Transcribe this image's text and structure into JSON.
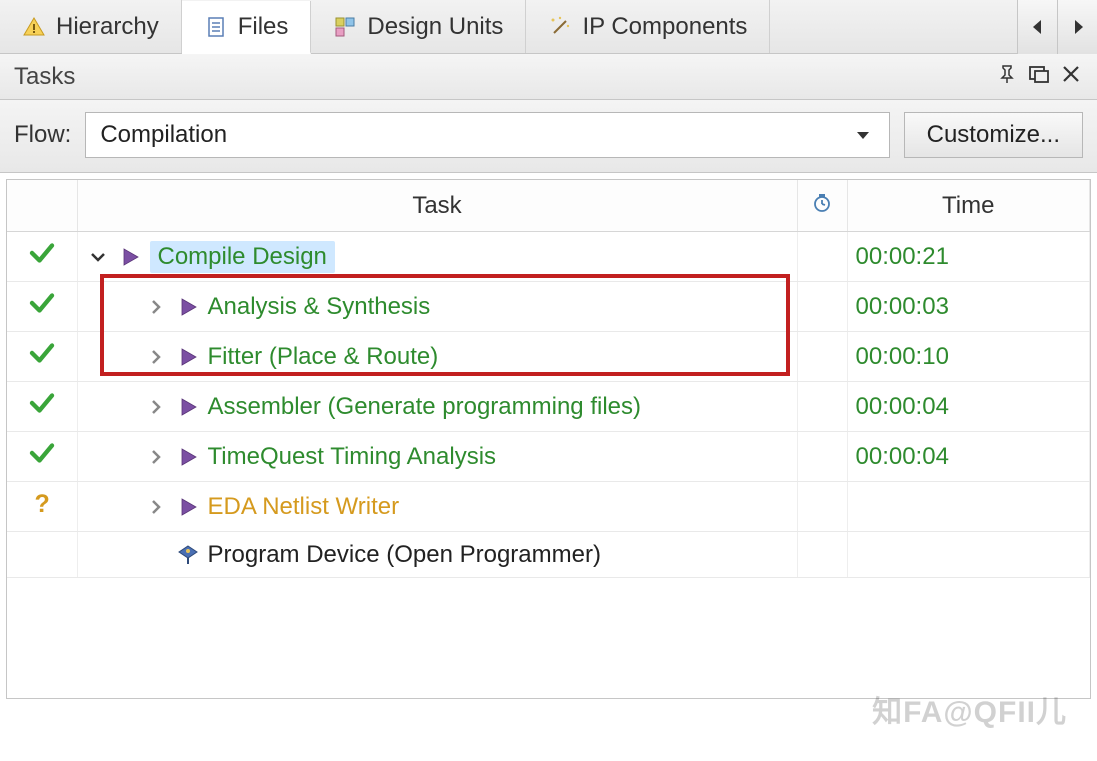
{
  "tabs": [
    {
      "label": "Hierarchy"
    },
    {
      "label": "Files"
    },
    {
      "label": "Design Units"
    },
    {
      "label": "IP Components"
    }
  ],
  "panel": {
    "title": "Tasks"
  },
  "flow": {
    "label": "Flow:",
    "value": "Compilation",
    "customize": "Customize..."
  },
  "columns": {
    "task": "Task",
    "time": "Time"
  },
  "rows": [
    {
      "status": "check",
      "expand": "down",
      "icon": "play",
      "label": "Compile Design",
      "color": "green",
      "time": "00:00:21",
      "indent": 1,
      "selected": true
    },
    {
      "status": "check",
      "expand": "right",
      "icon": "play",
      "label": "Analysis & Synthesis",
      "color": "green",
      "time": "00:00:03",
      "indent": 2
    },
    {
      "status": "check",
      "expand": "right",
      "icon": "play",
      "label": "Fitter (Place & Route)",
      "color": "green",
      "time": "00:00:10",
      "indent": 2
    },
    {
      "status": "check",
      "expand": "right",
      "icon": "play",
      "label": "Assembler (Generate programming files)",
      "color": "green",
      "time": "00:00:04",
      "indent": 2
    },
    {
      "status": "check",
      "expand": "right",
      "icon": "play",
      "label": "TimeQuest Timing Analysis",
      "color": "green",
      "time": "00:00:04",
      "indent": 2
    },
    {
      "status": "question",
      "expand": "right",
      "icon": "play",
      "label": "EDA Netlist Writer",
      "color": "orange",
      "time": "",
      "indent": 2
    },
    {
      "status": "",
      "expand": "",
      "icon": "device",
      "label": "Program Device (Open Programmer)",
      "color": "black",
      "time": "",
      "indent": 2
    }
  ],
  "watermark": "知FA@QFII儿"
}
